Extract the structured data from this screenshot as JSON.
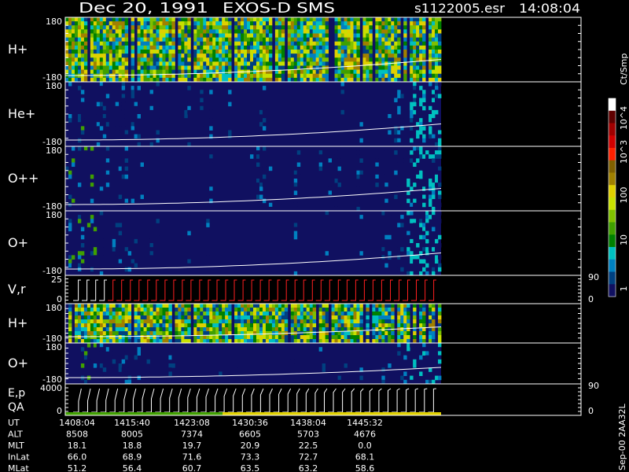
{
  "header": {
    "date": "Dec 20, 1991",
    "instrument": "EXOS-D SMS",
    "file": "s1122005.esr",
    "time": "14:08:04"
  },
  "colorbar": {
    "unit": "Ct/Smp",
    "labels": [
      "10^4",
      "10^3",
      "100",
      "10",
      "1"
    ],
    "colors": [
      "#ffffff",
      "#600000",
      "#a00000",
      "#d00000",
      "#ff2000",
      "#806000",
      "#a08000",
      "#e0d000",
      "#c8e000",
      "#80c000",
      "#40a000",
      "#008000",
      "#00c0c0",
      "#0080c0",
      "#004080",
      "#101060"
    ]
  },
  "chart_data": [
    {
      "type": "heatmap",
      "panel": "H+",
      "label": "H+",
      "ylim": [
        -180,
        180
      ],
      "ticks": [
        "180",
        "-180"
      ],
      "right_labels": []
    },
    {
      "type": "heatmap",
      "panel": "He+",
      "label": "He+",
      "ylim": [
        -180,
        180
      ],
      "ticks": [
        "180",
        "-180"
      ],
      "right_labels": []
    },
    {
      "type": "heatmap",
      "panel": "O++",
      "label": "O++",
      "ylim": [
        -180,
        180
      ],
      "ticks": [
        "180",
        "-180"
      ],
      "right_labels": []
    },
    {
      "type": "heatmap",
      "panel": "O+",
      "label": "O+",
      "ylim": [
        -180,
        180
      ],
      "ticks": [
        "180",
        "-180"
      ],
      "right_labels": []
    },
    {
      "type": "line",
      "panel": "Vr",
      "label": "V,r",
      "ylim": [
        0,
        25
      ],
      "ticks": [
        "25",
        "0"
      ],
      "right_labels": [
        "90",
        "0"
      ]
    },
    {
      "type": "heatmap",
      "panel": "H+ (2)",
      "label": "H+",
      "ylim": [
        -180,
        180
      ],
      "ticks": [
        "180",
        "-180"
      ],
      "right_labels": []
    },
    {
      "type": "heatmap",
      "panel": "O+ (2)",
      "label": "O+",
      "ylim": [
        -180,
        180
      ],
      "ticks": [
        "180",
        "-180"
      ],
      "right_labels": []
    },
    {
      "type": "line",
      "panel": "Ep/QA",
      "label": "E,p",
      "label2": "QA",
      "ylim": [
        0,
        4000
      ],
      "ticks": [
        "4000",
        "0"
      ],
      "right_labels": [
        "90",
        "0"
      ]
    }
  ],
  "orbit_table": {
    "rows": [
      {
        "name": "UT",
        "values": [
          "1408:04",
          "1415:40",
          "1423:08",
          "1430:36",
          "1438:04",
          "1445:32"
        ]
      },
      {
        "name": "ALT",
        "values": [
          "8508",
          "8005",
          "7374",
          "6605",
          "5703",
          "4676"
        ]
      },
      {
        "name": "MLT",
        "values": [
          "18.1",
          "18.8",
          "19.7",
          "20.9",
          "22.5",
          "0.0"
        ]
      },
      {
        "name": "InLat",
        "values": [
          "66.0",
          "68.9",
          "71.6",
          "73.3",
          "72.7",
          "68.1"
        ]
      },
      {
        "name": "MLat",
        "values": [
          "51.2",
          "56.4",
          "60.7",
          "63.5",
          "63.2",
          "58.6"
        ]
      }
    ]
  },
  "footer": {
    "side_text": "Sep-00  2AA32L"
  }
}
